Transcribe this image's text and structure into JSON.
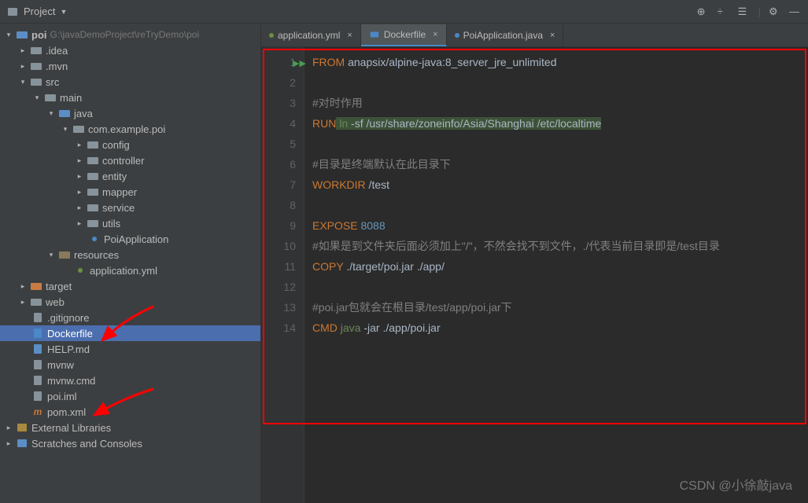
{
  "toolbar": {
    "project_label": "Project"
  },
  "project": {
    "root": "poi",
    "root_path": "G:\\javaDemoProject\\reTryDemo\\poi",
    "idea": ".idea",
    "mvn": ".mvn",
    "src": "src",
    "main": "main",
    "java": "java",
    "pkg": "com.example.poi",
    "config": "config",
    "controller": "controller",
    "entity": "entity",
    "mapper": "mapper",
    "service": "service",
    "utils": "utils",
    "poi_app": "PoiApplication",
    "resources": "resources",
    "app_yml": "application.yml",
    "target": "target",
    "web": "web",
    "gitignore": ".gitignore",
    "dockerfile": "Dockerfile",
    "help": "HELP.md",
    "mvnw": "mvnw",
    "mvnwcmd": "mvnw.cmd",
    "poiiml": "poi.iml",
    "pomxml": "pom.xml",
    "ext_lib": "External Libraries",
    "scratches": "Scratches and Consoles"
  },
  "tabs": {
    "t1": "application.yml",
    "t2": "Dockerfile",
    "t3": "PoiApplication.java"
  },
  "code": {
    "l1a": "FROM",
    "l1b": " anapsix/alpine-java:8_server_jre_unlimited",
    "l3": "#对时作用",
    "l4a": "RUN",
    "l4b": " ln",
    "l4c": " -sf /usr/share/zoneinfo/Asia/Shanghai /etc/localtime",
    "l6": "#目录是终端默认在此目录下",
    "l7a": "WORKDIR",
    "l7b": " /test",
    "l9a": "EXPOSE",
    "l9b": " 8088",
    "l10": "#如果是到文件夹后面必须加上\"/\"，不然会找不到文件，./代表当前目录即是/test目录",
    "l11a": "COPY",
    "l11b": " ./target/poi.jar ./app/",
    "l13": "#poi.jar包就会在根目录/test/app/poi.jar下",
    "l14a": "CMD",
    "l14b": " java",
    "l14c": " -jar ./app/poi.jar"
  },
  "watermark": "CSDN @小徐敲java"
}
